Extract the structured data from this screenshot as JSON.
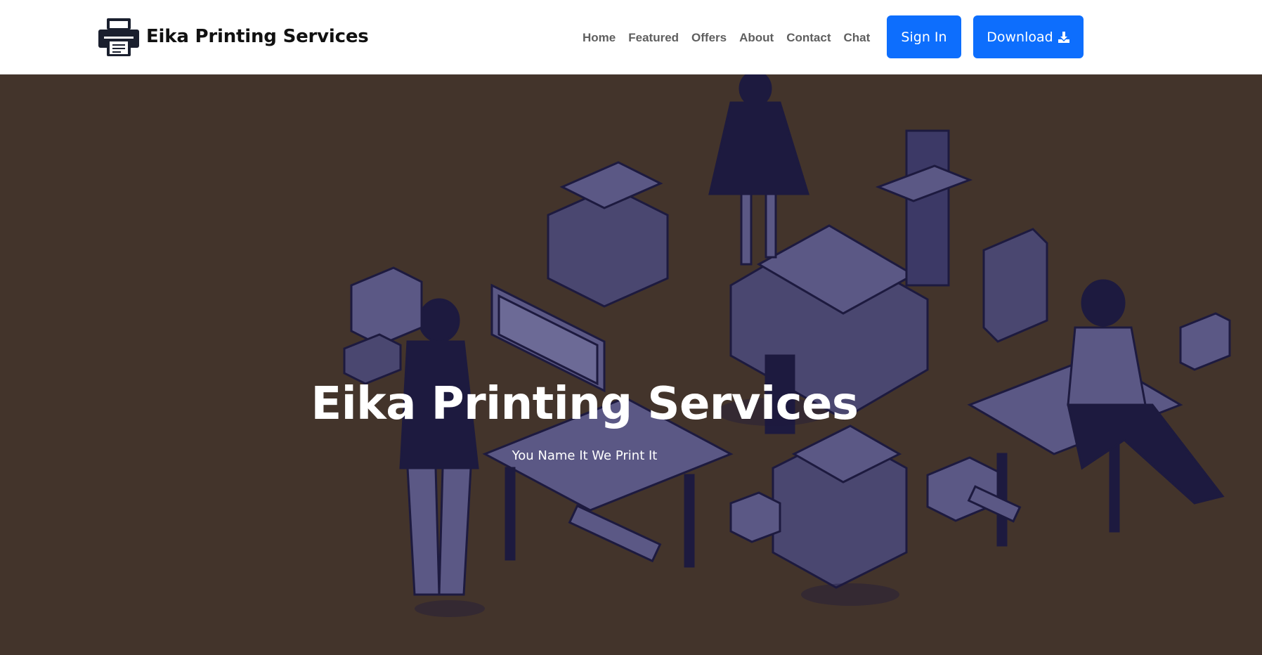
{
  "brand": {
    "name": "Eika Printing Services",
    "icon": "printer-icon"
  },
  "nav": {
    "items": [
      "Home",
      "Featured",
      "Offers",
      "About",
      "Contact",
      "Chat"
    ]
  },
  "actions": {
    "signin_label": "Sign In",
    "download_label": "Download",
    "download_icon": "download-icon"
  },
  "hero": {
    "title": "Eika Printing Services",
    "subtitle": "You Name It We Print It",
    "background_color": "#43342b",
    "illustration": "isometric-print-shop-illustration"
  },
  "colors": {
    "primary_button": "#0d6efd",
    "nav_text": "#5f5f5f",
    "illustration_dark": "#1d1a3f",
    "illustration_mid": "#4a4770"
  }
}
